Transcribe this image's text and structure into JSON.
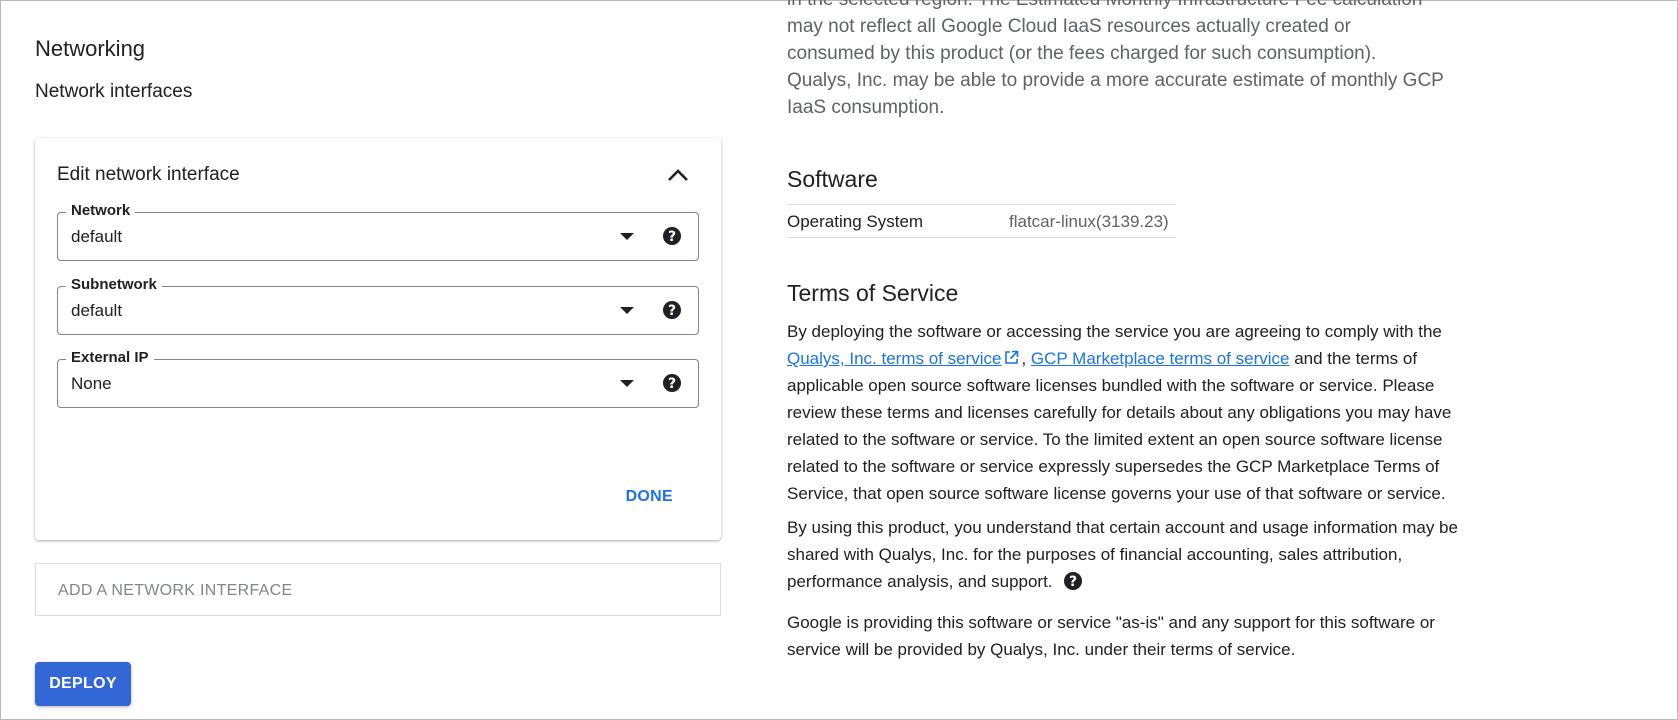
{
  "networking": {
    "title": "Networking",
    "subtitle": "Network interfaces",
    "card": {
      "title": "Edit network interface",
      "fields": [
        {
          "label": "Network",
          "value": "default"
        },
        {
          "label": "Subnetwork",
          "value": "default"
        },
        {
          "label": "External IP",
          "value": "None"
        }
      ],
      "done_label": "DONE"
    },
    "add_interface_label": "ADD A NETWORK INTERFACE",
    "deploy_label": "DEPLOY"
  },
  "fee_note": {
    "lines": [
      "in the selected region. The Estimated Monthly Infrastructure Fee calculation",
      "may not reflect all Google Cloud IaaS resources actually created or",
      "consumed by this product (or the fees charged for such consumption).",
      "Qualys, Inc. may be able to provide a more accurate estimate of monthly GCP",
      "IaaS consumption."
    ]
  },
  "software": {
    "title": "Software",
    "rows": [
      {
        "key": "Operating System",
        "value": "flatcar-linux(3139.23)"
      }
    ]
  },
  "tos": {
    "title": "Terms of Service",
    "p1_before": "By deploying the software or accessing the service you are agreeing to comply with the",
    "link_vendor": "Qualys, Inc. terms of service",
    "comma": ",",
    "link_marketplace": "GCP Marketplace terms of service",
    "p1_after": "and the terms of applicable open source software licenses bundled with the software or service. Please review these terms and licenses carefully for details about any obligations you may have related to the software or service. To the limited extent an open source software license related to the software or service expressly supersedes the GCP Marketplace Terms of Service, that open source software license governs your use of that software or service.",
    "p2": "By using this product, you understand that certain account and usage information may be shared with Qualys, Inc. for the purposes of financial accounting, sales attribution, performance analysis, and support.",
    "p3": "Google is providing this software or service \"as-is\" and any support for this software or service will be provided by Qualys, Inc. under their terms of service."
  }
}
